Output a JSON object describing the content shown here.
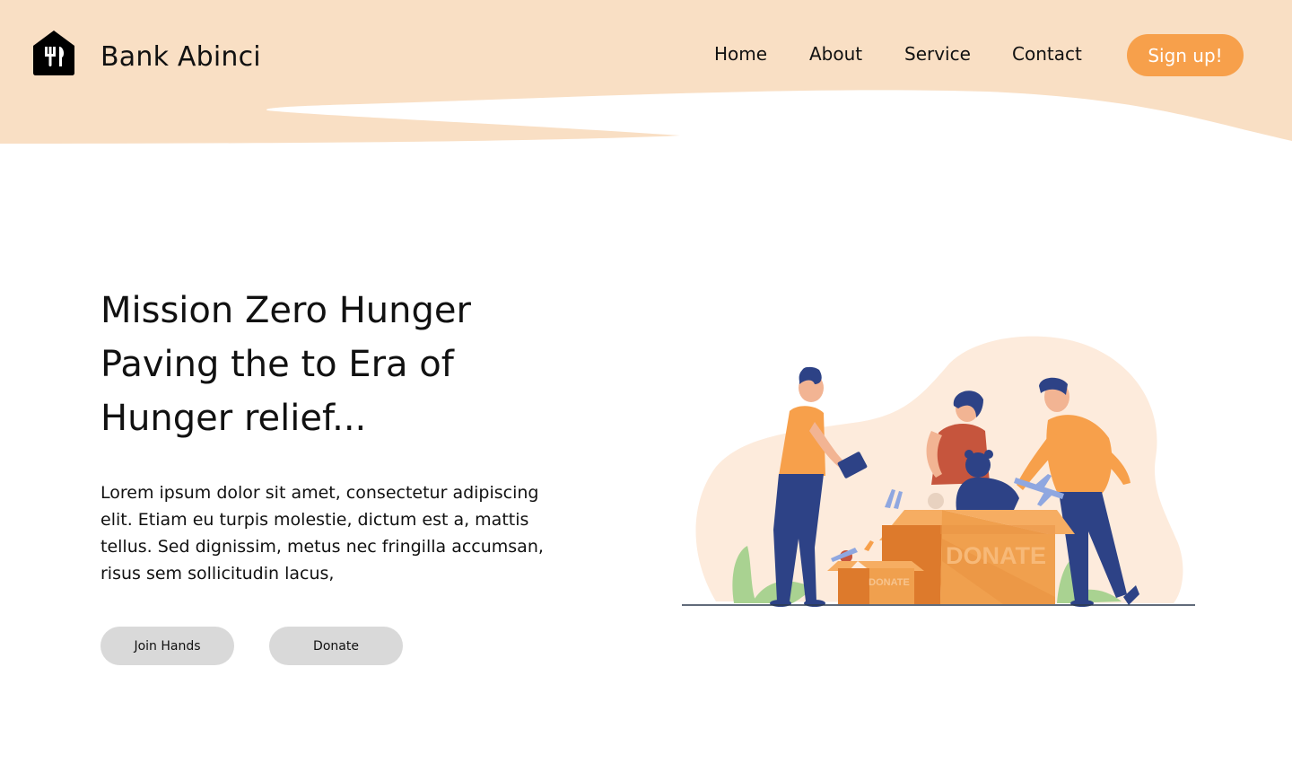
{
  "brand": {
    "name": "Bank Abinci",
    "logo_icon": "house-fork-knife-icon"
  },
  "nav": {
    "items": [
      {
        "label": "Home"
      },
      {
        "label": "About"
      },
      {
        "label": "Service"
      },
      {
        "label": "Contact"
      }
    ],
    "signup_label": "Sign up!"
  },
  "hero": {
    "title_lines": [
      "Mission Zero Hunger",
      "Paving the to Era of",
      "Hunger relief..."
    ],
    "description_lines": [
      "Lorem ipsum dolor sit amet, consectetur adipiscing",
      "elit. Etiam eu turpis molestie, dictum est a, mattis",
      "tellus. Sed dignissim, metus nec fringilla accumsan,",
      "risus sem sollicitudin lacus,"
    ],
    "buttons": {
      "join_label": "Join Hands",
      "donate_label": "Donate"
    }
  },
  "illustration": {
    "box_large_label": "DONATE",
    "box_small_label": "DONATE"
  },
  "colors": {
    "header_bg": "#f9dfc4",
    "accent": "#f7a04b",
    "button_bg": "#d9d9d9",
    "blob": "#fdebdc",
    "navy": "#2d4286",
    "box": "#f0a04e",
    "box_dark": "#dd7a2c"
  }
}
